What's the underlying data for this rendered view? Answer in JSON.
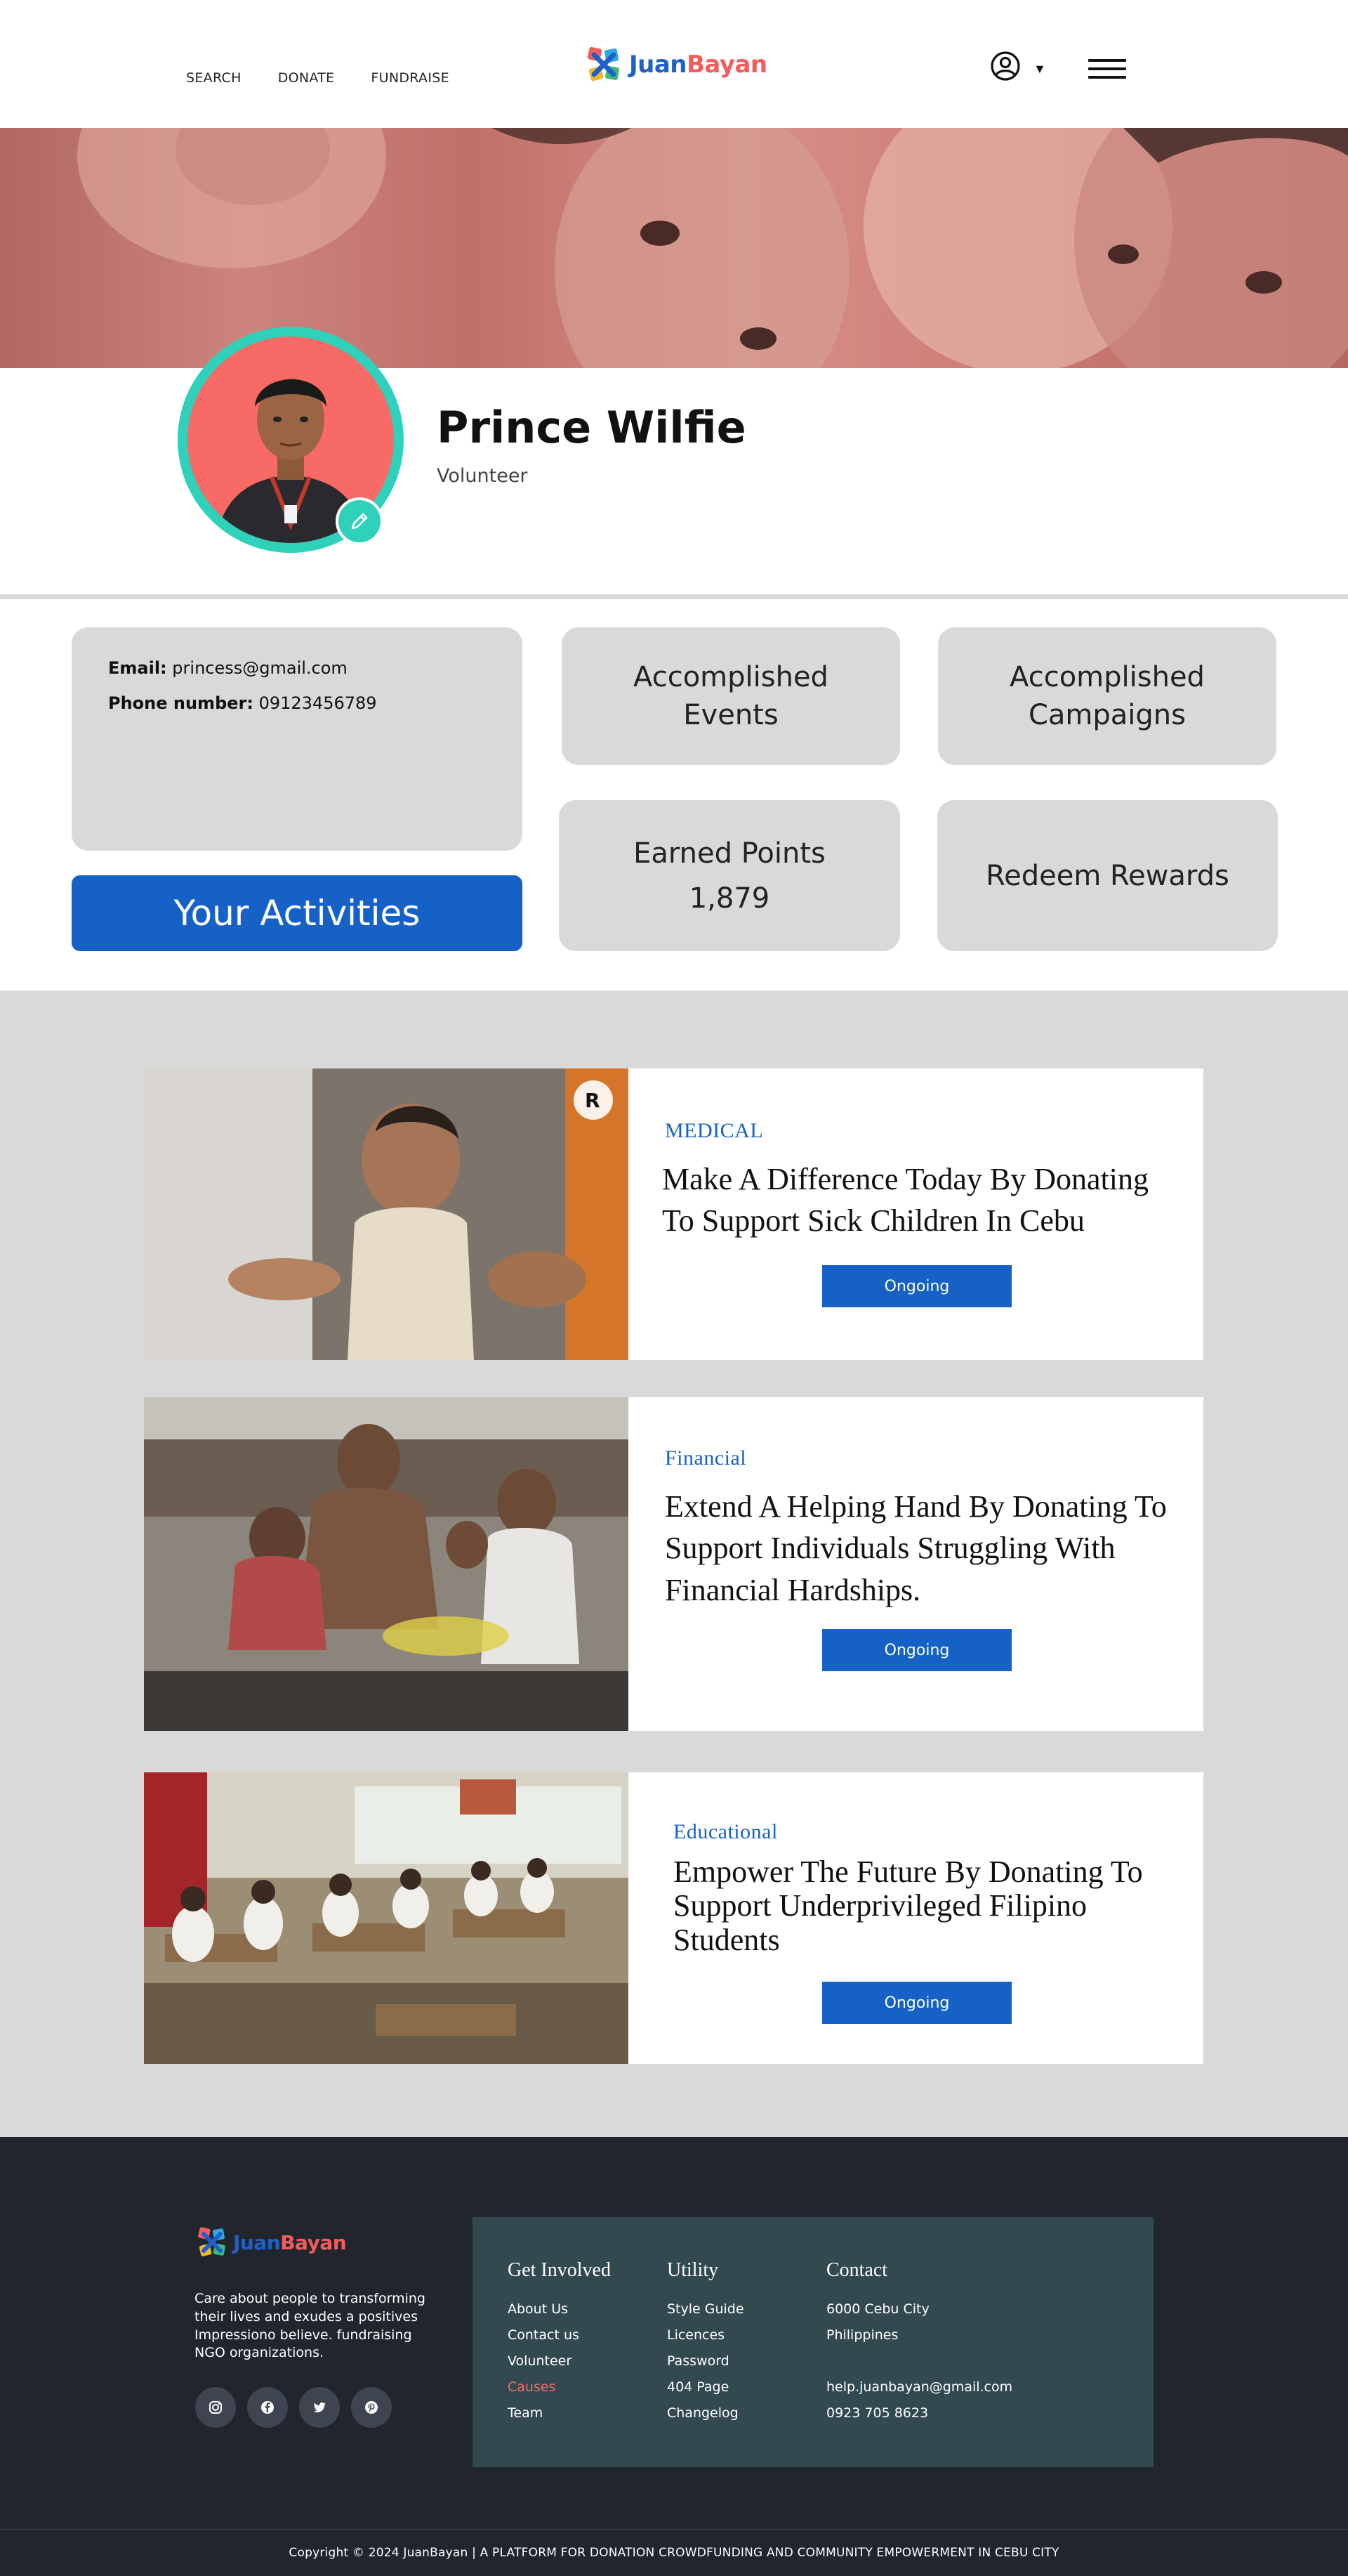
{
  "brand": {
    "part1": "Juan",
    "part2": "Bayan",
    "primary": "#1f5fc8",
    "accent": "#f25c5c"
  },
  "nav": {
    "search": "SEARCH",
    "donate": "DONATE",
    "fundraise": "FUNDRAISE"
  },
  "header": {
    "account_icon": "user-circle-icon",
    "dropdown_icon": "caret-down-icon",
    "menu_icon": "hamburger-menu-icon"
  },
  "profile": {
    "name": "Prince Wilfie",
    "role": "Volunteer",
    "edit_icon": "pencil-icon",
    "ring_color": "#2fd1bb"
  },
  "contact": {
    "email_label": "Email:",
    "email": "princess@gmail.com",
    "phone_label": "Phone number:",
    "phone": "09123456789"
  },
  "activities_button": "Your Activities",
  "stats": {
    "events_line1": "Accomplished",
    "events_line2": "Events",
    "campaigns_line1": "Accomplished",
    "campaigns_line2": "Campaigns",
    "points_label": "Earned Points",
    "points_value": "1,879",
    "redeem_label": "Redeem Rewards"
  },
  "causes": [
    {
      "category": "MEDICAL",
      "title": "Make A Difference Today By Donating To Support Sick Children In Cebu",
      "status": "Ongoing"
    },
    {
      "category": "Financial",
      "title": "Extend A Helping Hand By Donating To Support Individuals Struggling With Financial Hardships.",
      "status": "Ongoing"
    },
    {
      "category": "Educational",
      "title": "Empower The Future By Donating To Support Underprivileged Filipino Students",
      "status": "Ongoing"
    }
  ],
  "footer": {
    "about": "Care about people to transforming their lives and exudes a positives Impressiono believe. fundraising NGO organizations.",
    "socials": [
      "instagram-icon",
      "facebook-icon",
      "twitter-icon",
      "pinterest-icon"
    ],
    "get_involved": {
      "heading": "Get Involved",
      "links": [
        "About Us",
        "Contact us",
        "Volunteer",
        "Causes",
        "Team"
      ]
    },
    "utility": {
      "heading": "Utility",
      "links": [
        "Style Guide",
        "Licences",
        "Password",
        "404 Page",
        "Changelog"
      ]
    },
    "contact": {
      "heading": "Contact",
      "city": "6000 Cebu City",
      "country": "Philippines",
      "email": "help.juanbayan@gmail.com",
      "phone": "0923 705 8623"
    },
    "copyright": "Copyright © 2024 JuanBayan | A PLATFORM FOR DONATION CROWDFUNDING AND COMMUNITY EMPOWERMENT IN CEBU CITY"
  }
}
